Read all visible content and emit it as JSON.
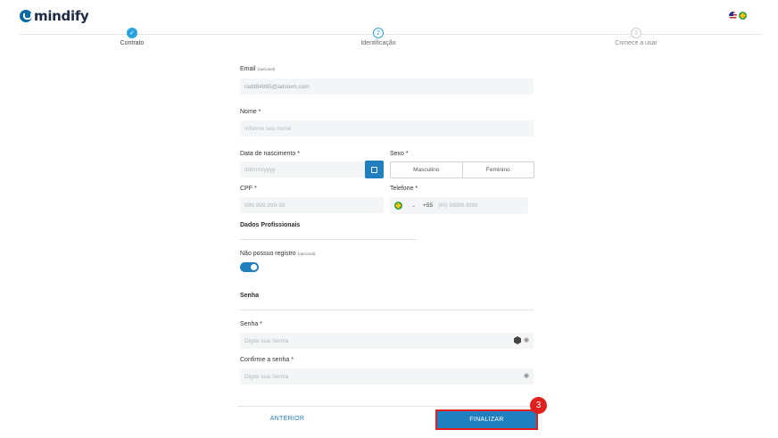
{
  "header": {
    "logo_text": "mindify",
    "languages": [
      "us-flag",
      "br-flag"
    ]
  },
  "steps": [
    {
      "label": "Contrato",
      "number": "",
      "state": "done"
    },
    {
      "label": "Identificação",
      "number": "2",
      "state": "active"
    },
    {
      "label": "Comece a usar",
      "number": "3",
      "state": "todo"
    }
  ],
  "form": {
    "email": {
      "label": "Email",
      "optional": "(opcional)",
      "value": "radit84865@adstem.com"
    },
    "nome": {
      "label": "Nome *",
      "placeholder": "Informe seu nome"
    },
    "nascimento": {
      "label": "Data de nascimento *",
      "placeholder": "dd/mm/yyyy"
    },
    "sexo": {
      "label": "Sexo *",
      "options": [
        "Masculino",
        "Feminino"
      ]
    },
    "cpf": {
      "label": "CPF *",
      "placeholder": "999.999.999-99"
    },
    "telefone": {
      "label": "Telefone *",
      "country_code": "+55",
      "placeholder": "(99) 99999-9999"
    },
    "profissionais": {
      "title": "Dados Profissionais",
      "no_registry_label": "Não possuo registro",
      "no_registry_optional": "(opcional)",
      "toggle_on": true
    },
    "senha_section": {
      "title": "Senha"
    },
    "senha": {
      "label": "Senha *",
      "placeholder": "Digite sua Senha"
    },
    "confirm": {
      "label": "Confirme a senha *",
      "placeholder": "Digite sua Senha"
    }
  },
  "footer": {
    "prev_label": "ANTERIOR",
    "finish_label": "FINALIZAR",
    "annotation_badge": "3"
  },
  "colors": {
    "primary": "#1f7fbf",
    "step_accent": "#29a3e0",
    "highlight": "#e0201f"
  }
}
